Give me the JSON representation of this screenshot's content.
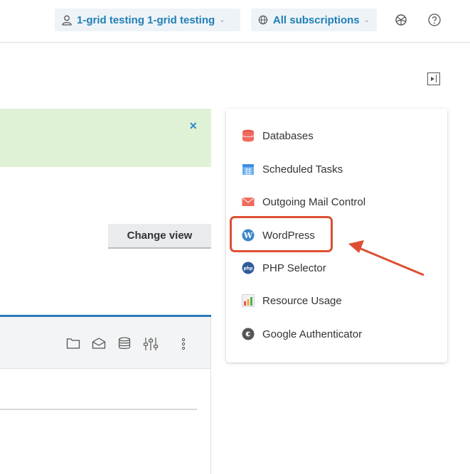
{
  "header": {
    "user_label": "1-grid testing 1-grid testing",
    "subscriptions_label": "All subscriptions",
    "icons": [
      "user-icon",
      "globe-icon",
      "shield-icon",
      "help-icon",
      "chevron-down-icon"
    ]
  },
  "toolbar": {
    "change_view_label": "Change view",
    "alert_close": "×"
  },
  "sidebar": {
    "items": [
      {
        "label": "Databases",
        "icon": "database-icon"
      },
      {
        "label": "Scheduled Tasks",
        "icon": "calendar-icon"
      },
      {
        "label": "Outgoing Mail Control",
        "icon": "mail-icon"
      },
      {
        "label": "WordPress",
        "icon": "wordpress-icon"
      },
      {
        "label": "PHP Selector",
        "icon": "php-icon"
      },
      {
        "label": "Resource Usage",
        "icon": "bar-chart-icon"
      },
      {
        "label": "Google Authenticator",
        "icon": "authenticator-icon"
      }
    ]
  },
  "panel": {
    "icons": [
      "folder-icon",
      "mail-icon",
      "database-icon",
      "settings-sliders-icon",
      "more-vertical-icon"
    ]
  },
  "colors": {
    "accent": "#1f7fb5",
    "highlight": "#de4f32",
    "alert_bg": "#dff2d6"
  }
}
